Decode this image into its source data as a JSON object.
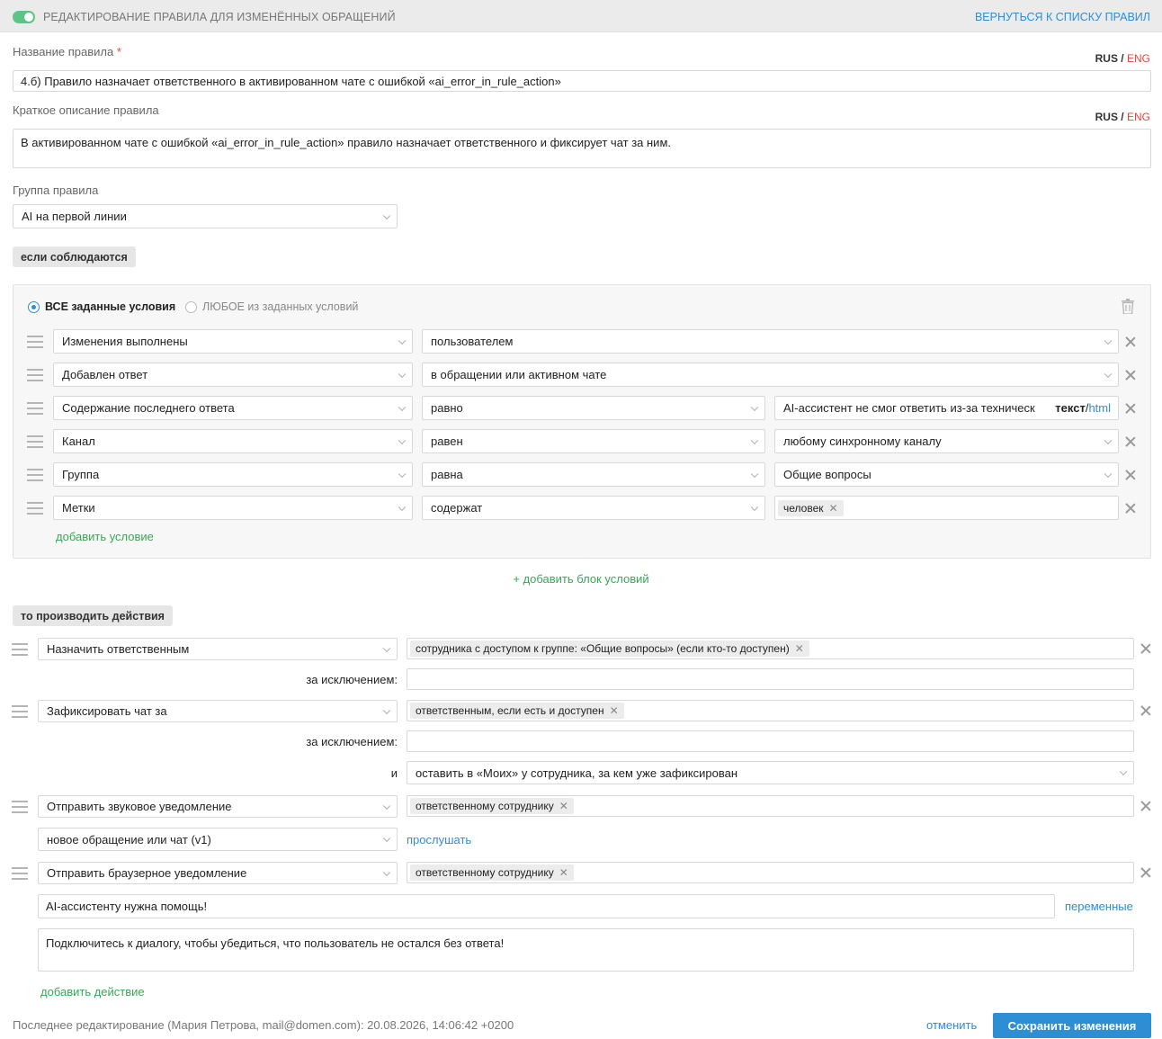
{
  "header": {
    "title": "РЕДАКТИРОВАНИЕ ПРАВИЛА ДЛЯ ИЗМЕНЁННЫХ ОБРАЩЕНИЙ",
    "back_link": "ВЕРНУТЬСЯ К СПИСКУ ПРАВИЛ",
    "toggle_on": true,
    "toggle_color": "#5cc486"
  },
  "lang": {
    "rus": "RUS",
    "sep": " / ",
    "eng": "ENG"
  },
  "rule_name": {
    "label": "Название правила",
    "required_mark": "*",
    "value": "4.б) Правило назначает ответственного в активированном чате с ошибкой «ai_error_in_rule_action»"
  },
  "rule_description": {
    "label": "Краткое описание правила",
    "value": "В активированном чате с ошибкой «ai_error_in_rule_action» правило назначает ответственного и фиксирует чат за ним."
  },
  "rule_group": {
    "label": "Группа правила",
    "value": "AI на первой линии"
  },
  "conditions": {
    "section_label": "если соблюдаются",
    "mode_all": "ВСЕ заданные условия",
    "mode_any": "ЛЮБОЕ из заданных условий",
    "rows": [
      {
        "field": "Изменения выполнены",
        "op": "пользователем"
      },
      {
        "field": "Добавлен ответ",
        "op": "в обращении или активном чате"
      },
      {
        "field": "Содержание последнего ответа",
        "op": "равно",
        "value": "AI-ассистент не смог ответить из-за техническ",
        "fmt_text": "текст",
        "fmt_sep": " / ",
        "fmt_html": "html"
      },
      {
        "field": "Канал",
        "op": "равен",
        "value": "любому синхронному каналу"
      },
      {
        "field": "Группа",
        "op": "равна",
        "value": "Общие вопросы"
      },
      {
        "field": "Метки",
        "op": "содержат",
        "tag": "человек"
      }
    ],
    "add_condition": "добавить условие",
    "add_block": "+ добавить блок условий"
  },
  "actions": {
    "section_label": "то производить действия",
    "assign": {
      "action": "Назначить ответственным",
      "tag": "сотрудника с доступом к группе: «Общие вопросы» (если кто-то доступен)",
      "except_label": "за исключением:"
    },
    "pin": {
      "action": "Зафиксировать чат за",
      "tag": "ответственным, если есть и доступен",
      "except_label": "за исключением:",
      "and_label": "и",
      "and_value": "оставить в «Моих» у сотрудника, за кем уже зафиксирован"
    },
    "sound": {
      "action": "Отправить звуковое уведомление",
      "tag": "ответственному сотруднику",
      "sound_value": "новое обращение или чат (v1)",
      "listen": "прослушать"
    },
    "browser": {
      "action": "Отправить браузерное уведомление",
      "tag": "ответственному сотруднику",
      "title_value": "AI-ассистенту нужна помощь!",
      "variables": "переменные",
      "body_value": "Подключитесь к диалогу, чтобы убедиться, что пользователь не остался без ответа!"
    },
    "add_action": "добавить действие"
  },
  "footer": {
    "last_edit": "Последнее редактирование (Мария Петрова, mail@domen.com): 20.08.2026, 14:06:42 +0200",
    "cancel": "отменить",
    "save": "Сохранить изменения"
  },
  "colors": {
    "accent_blue": "#2d8ed4",
    "green": "#3aa757",
    "required_red": "#e2483d"
  }
}
